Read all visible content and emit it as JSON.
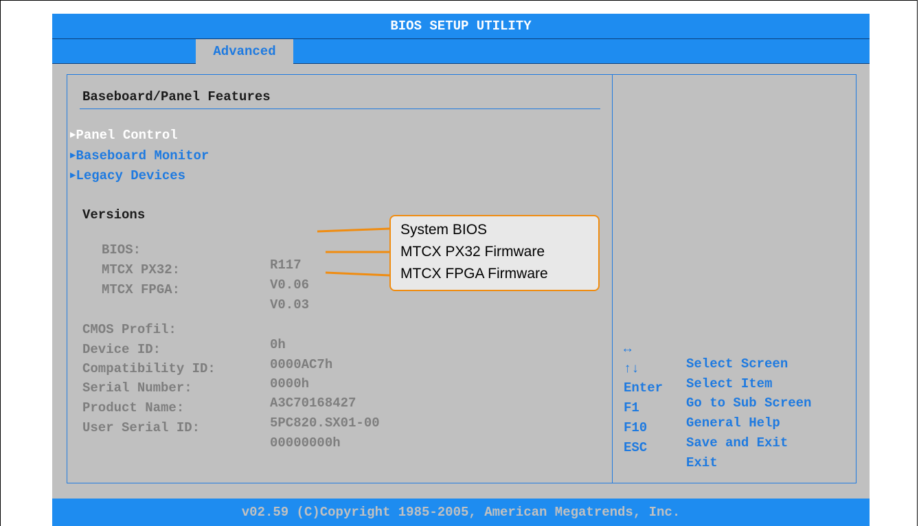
{
  "window": {
    "title": "BIOS SETUP UTILITY"
  },
  "tabs": [
    {
      "label": "Advanced",
      "active": true
    }
  ],
  "main": {
    "section_title": "Baseboard/Panel Features",
    "menu_items": [
      {
        "label": "Panel Control",
        "highlighted": true
      },
      {
        "label": "Baseboard Monitor",
        "highlighted": false
      },
      {
        "label": "Legacy Devices",
        "highlighted": false
      }
    ],
    "versions_heading": "Versions",
    "versions": [
      {
        "label": "BIOS:",
        "value": "R117"
      },
      {
        "label": "MTCX PX32:",
        "value": "V0.06"
      },
      {
        "label": "MTCX FPGA:",
        "value": "V0.03"
      }
    ],
    "info": [
      {
        "label": "CMOS Profil:",
        "value": "0h"
      },
      {
        "label": "Device ID:",
        "value": "0000AC7h"
      },
      {
        "label": "Compatibility ID:",
        "value": "0000h"
      },
      {
        "label": "Serial Number:",
        "value": "A3C70168427"
      },
      {
        "label": "Product Name:",
        "value": "5PC820.SX01-00"
      },
      {
        "label": "User Serial ID:",
        "value": "00000000h"
      }
    ]
  },
  "callout": {
    "lines": [
      "System BIOS",
      "MTCX PX32 Firmware",
      "MTCX FPGA Firmware"
    ]
  },
  "help": [
    {
      "key": "↔",
      "action": "Select Screen",
      "key_icon": "left-right-arrow-icon"
    },
    {
      "key": "↑↓",
      "action": "Select Item",
      "key_icon": "up-down-arrow-icon"
    },
    {
      "key": "Enter",
      "action": "Go to Sub Screen"
    },
    {
      "key": "F1",
      "action": "General Help"
    },
    {
      "key": "F10",
      "action": "Save and Exit"
    },
    {
      "key": "ESC",
      "action": "Exit"
    }
  ],
  "footer": {
    "text": "v02.59 (C)Copyright 1985-2005, American Megatrends, Inc."
  },
  "colors": {
    "bar_blue": "#1e8cf0",
    "panel_gray": "#c0c0c0",
    "accent_blue": "#1e7ae0",
    "callout_orange": "#f08c10"
  }
}
